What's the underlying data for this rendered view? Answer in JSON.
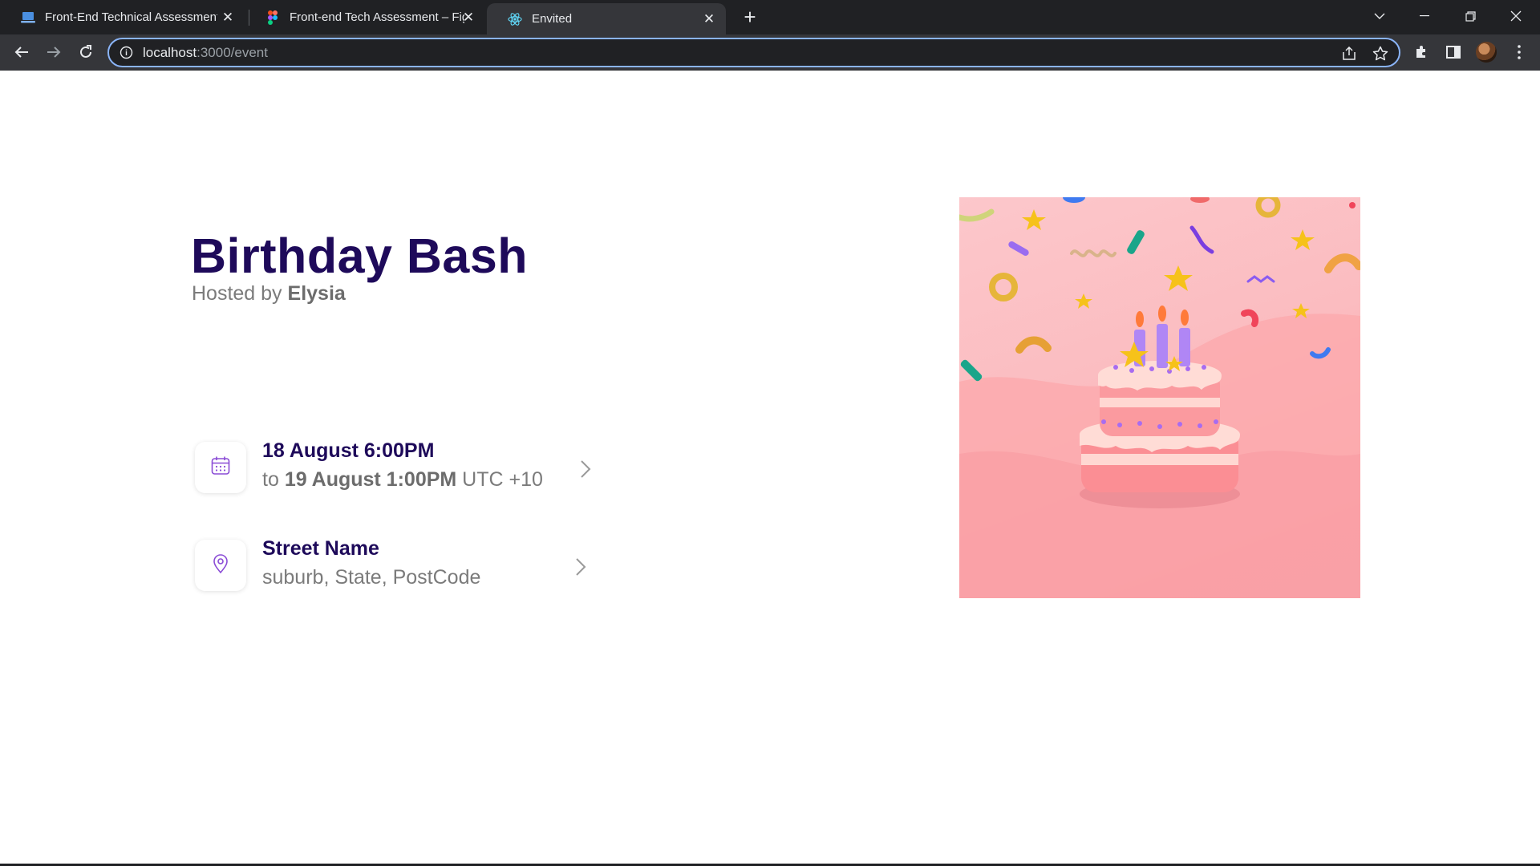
{
  "browser": {
    "tabs": [
      {
        "title": "Front-End Technical Assessment",
        "favicon": "laptop-icon",
        "active": false
      },
      {
        "title": "Front-end Tech Assessment – Figma",
        "favicon": "figma-icon",
        "active": false
      },
      {
        "title": "Envited",
        "favicon": "react-icon",
        "active": true
      }
    ],
    "new_tab_label": "+",
    "url_host": "localhost",
    "url_path": ":3000/event"
  },
  "event": {
    "title": "Birthday Bash",
    "hosted_prefix": "Hosted by",
    "host_name": "Elysia",
    "date": {
      "start": "18 August 6:00PM",
      "to_prefix": "to",
      "end": "19 August 1:00PM",
      "timezone": "UTC +10"
    },
    "location": {
      "street": "Street Name",
      "details": "suburb, State, PostCode"
    }
  },
  "colors": {
    "title": "#1e0a5a",
    "muted": "#7b7b7b",
    "icon_accent": "#8a4bd6",
    "hero_bg": "#fbbcc0"
  }
}
